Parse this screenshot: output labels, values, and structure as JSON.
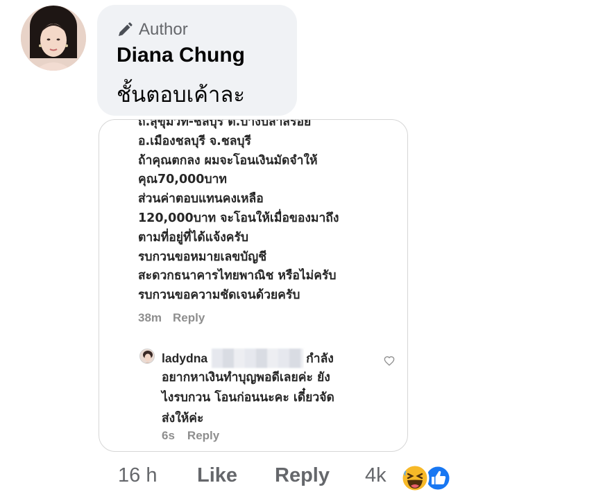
{
  "comment": {
    "author_badge": "Author",
    "commenter_name": "Diana Chung",
    "text": "ชั้นตอบเค้าละ"
  },
  "screenshot": {
    "message_lines": [
      "ถ.สุขุมวิท-ชลบุรี ต.บางปลาสร้อย",
      "อ.เมืองชลบุรี จ.ชลบุรี",
      "ถ้าคุณตกลง ผมจะโอนเงินมัดจำให้",
      "คุณ70,000บาท",
      "ส่วนค่าตอบแทนคงเหลือ",
      "120,000บาท จะโอนให้เมื่อของมาถึง",
      "ตามที่อยู่ที่ได้แจ้งครับ",
      "รบกวนขอหมายเลขบัญชี",
      "สะดวกธนาคารไทยพาณิช หรือไม่ครับ",
      "รบกวนขอความชัดเจนด้วยครับ"
    ],
    "message_time": "38m",
    "message_reply": "Reply",
    "reply": {
      "username": "ladydna",
      "line1_tail": "กำลัง",
      "lines": [
        "อยากหาเงินทำบุญพอดีเลยค่ะ ยัง",
        "ไงรบกวน โอนก่อนนะคะ เดี๋ยวจัด",
        "ส่งให้ค่ะ"
      ],
      "time": "6s",
      "reply_label": "Reply"
    }
  },
  "actions": {
    "time": "16 h",
    "like": "Like",
    "reply": "Reply",
    "reaction_count": "4k",
    "reactions": [
      "haha-reaction-icon",
      "like-reaction-icon"
    ]
  },
  "colors": {
    "bubble_bg": "#f0f2f5",
    "secondary_text": "#65676b",
    "like_blue": "#1877f2",
    "haha_yellow": "#f7b928"
  }
}
